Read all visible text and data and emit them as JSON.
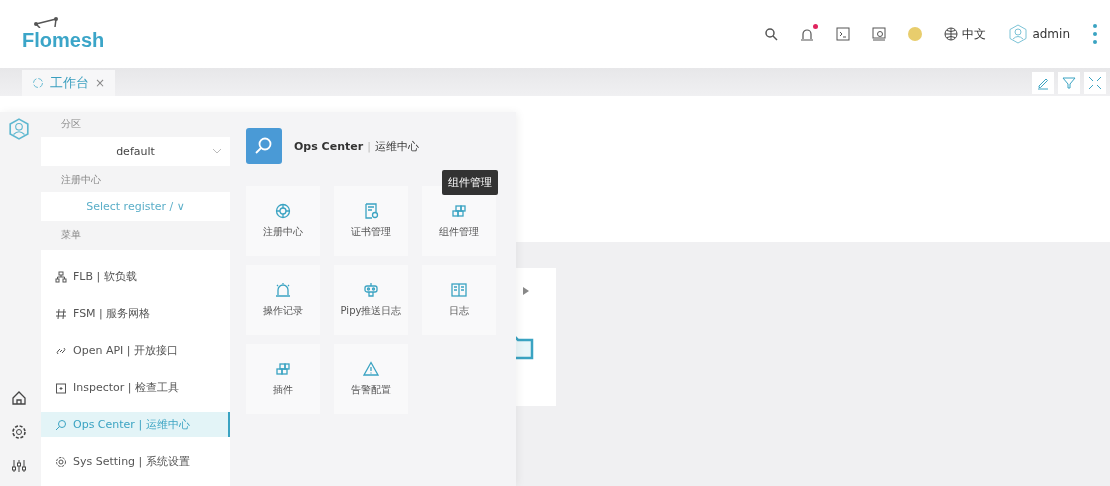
{
  "header": {
    "logo": "Flomesh",
    "language": "中文",
    "user": "admin",
    "alert_badge": true
  },
  "tabs": [
    {
      "label": "工作台",
      "close": "×",
      "selected": true
    }
  ],
  "menu_panel": {
    "partition_label": "分区",
    "partition_value": "default",
    "registry_label": "注册中心",
    "registry_placeholder": "Select register / ∨",
    "menu_label": "菜单",
    "items": [
      {
        "label": "FLB | 软负载",
        "selected": false
      },
      {
        "label": "FSM | 服务网格",
        "selected": false
      },
      {
        "label": "Open API | 开放接口",
        "selected": false
      },
      {
        "label": "Inspector | 检查工具",
        "selected": false
      },
      {
        "label": "Ops Center | 运维中心",
        "selected": true
      },
      {
        "label": "Sys Setting | 系统设置",
        "selected": false
      }
    ]
  },
  "ops_panel": {
    "title": "Ops Center",
    "separator": "|",
    "subtitle": "运维中心",
    "tooltip": "组件管理",
    "tiles": [
      {
        "label": "注册中心"
      },
      {
        "label": "证书管理"
      },
      {
        "label": "组件管理"
      },
      {
        "label": "操作记录"
      },
      {
        "label": "Pipy推送日志"
      },
      {
        "label": "日志"
      },
      {
        "label": "插件"
      },
      {
        "label": "告警配置"
      }
    ]
  }
}
